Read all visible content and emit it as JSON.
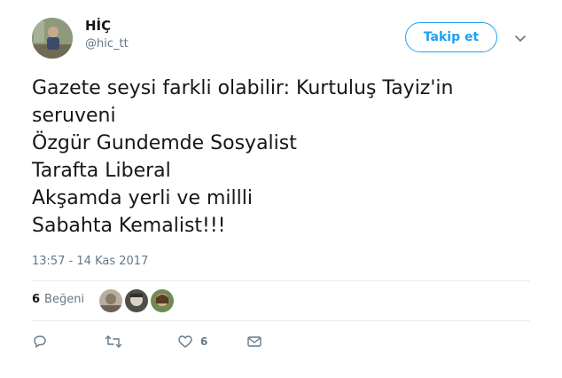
{
  "user": {
    "name": "HİÇ",
    "handle": "@hic_tt"
  },
  "follow_button": {
    "label": "Takip et"
  },
  "menu_icon": "chevron-down-icon",
  "tweet": {
    "lines": [
      "Gazete seysi farkli olabilir: Kurtuluş Tayiz'in",
      "seruveni",
      "Özgür Gundemde Sosyalist",
      "Tarafta Liberal",
      "Akşamda yerli ve millli",
      "Sabahta Kemalist!!!"
    ],
    "timestamp": "13:57 - 14 Kas 2017"
  },
  "likes": {
    "count": "6",
    "label": "Beğeni"
  },
  "actions": {
    "reply_icon": "reply-icon",
    "retweet_icon": "retweet-icon",
    "like_icon": "heart-icon",
    "like_count": "6",
    "message_icon": "envelope-icon"
  },
  "colors": {
    "accent": "#1da1f2",
    "muted": "#657786",
    "divider": "#e6ecf0"
  }
}
